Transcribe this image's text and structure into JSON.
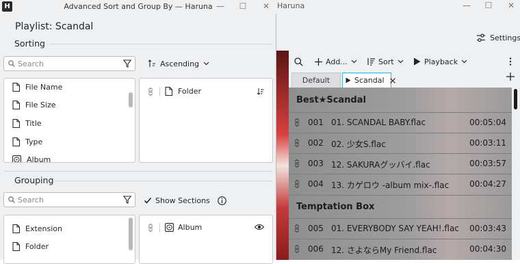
{
  "main_window": {
    "title": "Haruna",
    "settings_label": "Settings",
    "toolbar": {
      "add_label": "Add...",
      "sort_label": "Sort",
      "playback_label": "Playback"
    },
    "tabs": [
      {
        "label": "Default"
      },
      {
        "label": "Scandal"
      }
    ],
    "playlist": {
      "sections": [
        {
          "title": "Best★Scandal",
          "rows": [
            {
              "num": "001",
              "title": "01. SCANDAL BABY.flac",
              "duration": "00:05:04"
            },
            {
              "num": "002",
              "title": "02. 少女S.flac",
              "duration": "00:03:11"
            },
            {
              "num": "003",
              "title": "12. SAKURAグッバイ.flac",
              "duration": "00:03:57"
            },
            {
              "num": "004",
              "title": "13. カゲロウ -album mix-.flac",
              "duration": "00:04:27"
            }
          ]
        },
        {
          "title": "Temptation Box",
          "rows": [
            {
              "num": "005",
              "title": "01. EVERYBODY SAY YEAH!.flac",
              "duration": "00:03:43"
            },
            {
              "num": "006",
              "title": "12. さよならMy Friend.flac",
              "duration": "00:04:30"
            }
          ]
        }
      ]
    }
  },
  "dialog": {
    "title": "Advanced Sort and Group By — Haruna",
    "app_icon_letter": "H",
    "playlist_title": "Playlist: Scandal",
    "sorting": {
      "label": "Sorting",
      "search_placeholder": "Search",
      "order_label": "Ascending",
      "available": [
        "File Name",
        "File Size",
        "Title",
        "Type",
        "Album"
      ],
      "selected": [
        "Folder"
      ]
    },
    "grouping": {
      "label": "Grouping",
      "search_placeholder": "Search",
      "show_sections_label": "Show Sections",
      "show_sections_checked": true,
      "available": [
        "Extension",
        "Folder"
      ],
      "selected": [
        "Album"
      ]
    }
  },
  "colors": {
    "accent": "#3daee9",
    "playlist_bg": "#9e9e9e",
    "window_bg": "#eff0f1"
  }
}
